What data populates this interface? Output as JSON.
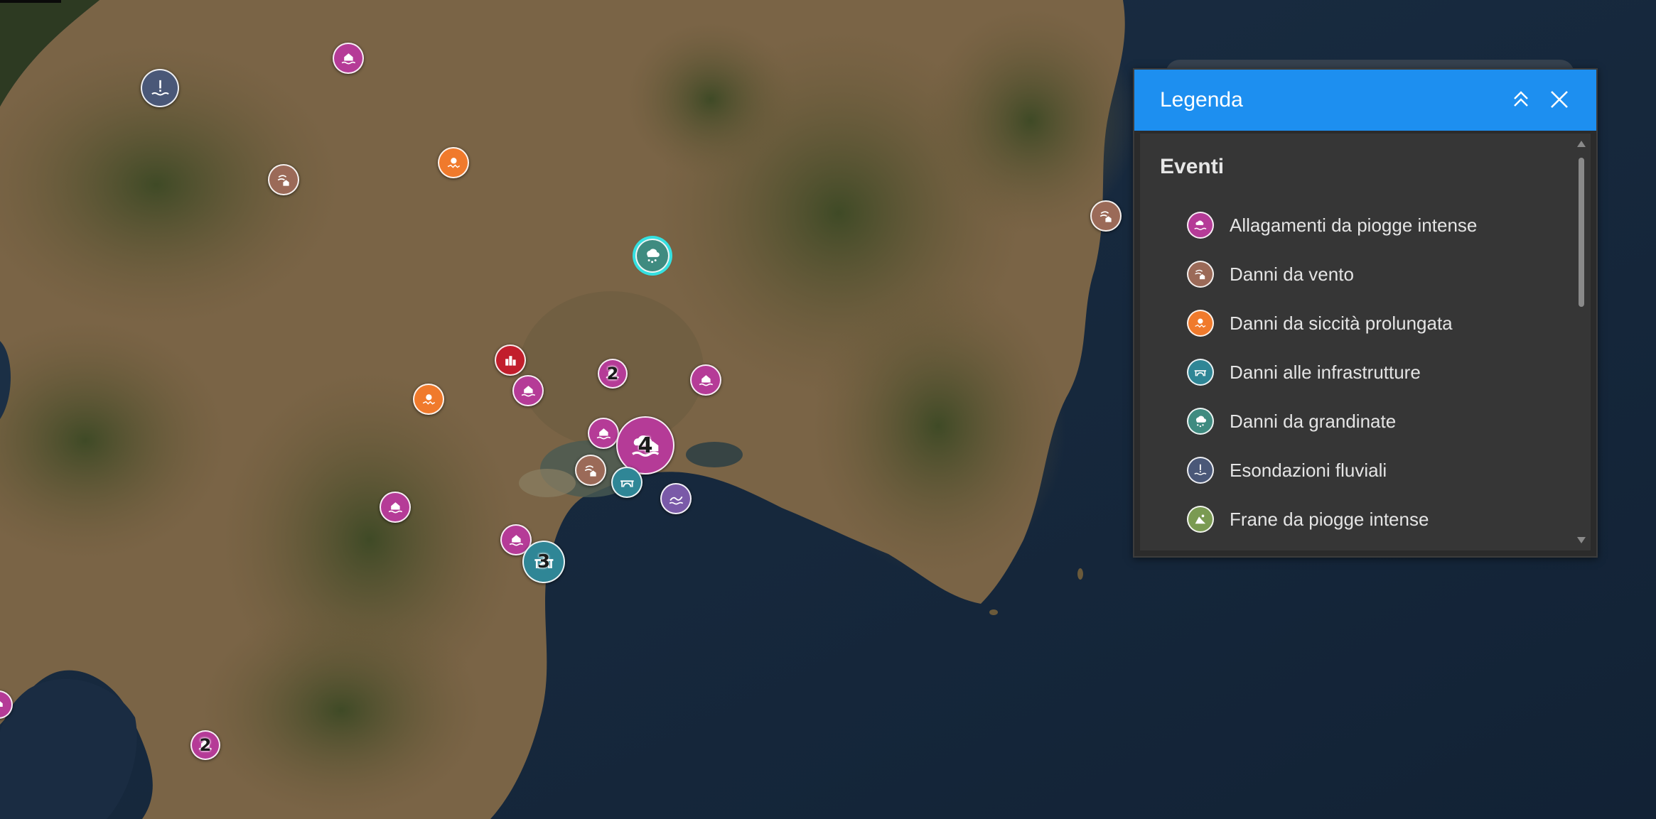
{
  "legend": {
    "title": "Legenda",
    "collapse_icon": "double-chevron-up-icon",
    "close_icon": "close-icon",
    "section_title": "Eventi",
    "items": [
      {
        "label": "Allagamenti da piogge intense",
        "color": "#b53b97",
        "icon": "flooded-house-icon"
      },
      {
        "label": "Danni da vento",
        "color": "#9b6a58",
        "icon": "wind-house-icon"
      },
      {
        "label": "Danni da siccità prolungata",
        "color": "#f07a2c",
        "icon": "drought-icon"
      },
      {
        "label": "Danni alle infrastrutture",
        "color": "#2f8696",
        "icon": "bridge-icon"
      },
      {
        "label": "Danni da grandinate",
        "color": "#3f8b80",
        "icon": "hail-icon"
      },
      {
        "label": "Esondazioni fluviali",
        "color": "#4a5878",
        "icon": "river-flood-icon"
      },
      {
        "label": "Frane da piogge intense",
        "color": "#7a9a52",
        "icon": "landslide-icon"
      }
    ]
  },
  "map": {
    "cluster_counts": {
      "large_flood_cluster": "4",
      "infra_cluster": "3",
      "flood_cluster_north": "2",
      "flood_cluster_south": "2"
    }
  }
}
